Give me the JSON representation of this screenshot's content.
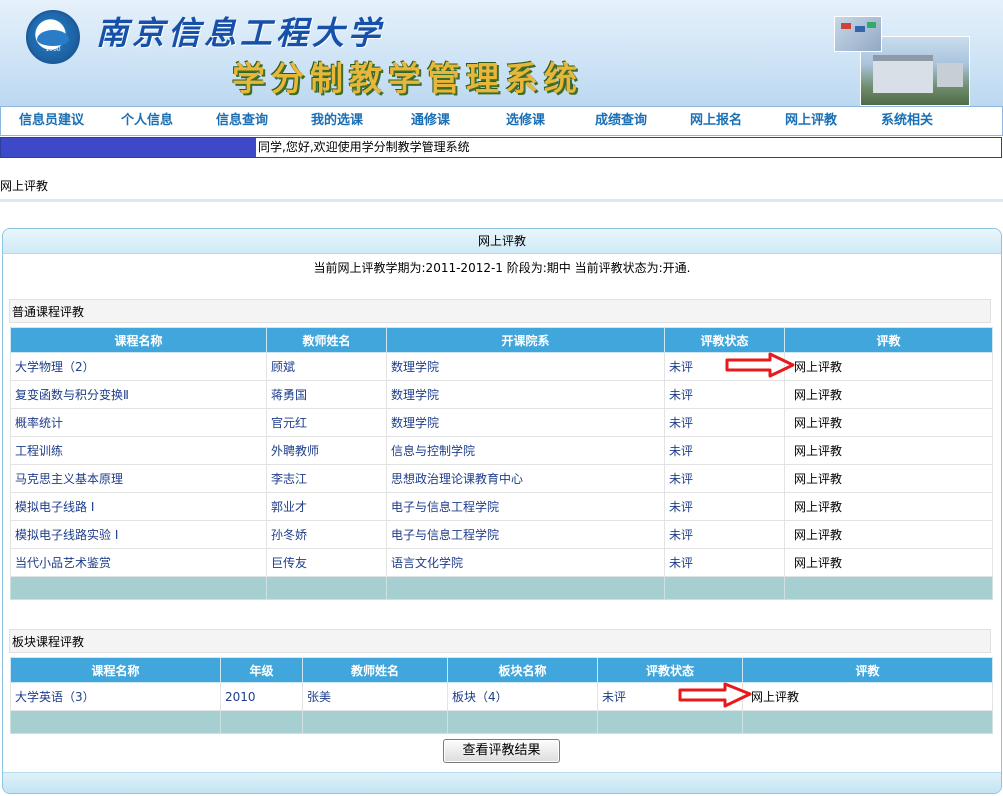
{
  "header": {
    "university": "南京信息工程大学",
    "system_name": "学分制教学管理系统",
    "logo_year": "1960"
  },
  "nav": [
    {
      "label": "信息员建议"
    },
    {
      "label": "个人信息"
    },
    {
      "label": "信息查询"
    },
    {
      "label": "我的选课"
    },
    {
      "label": "通修课"
    },
    {
      "label": "选修课"
    },
    {
      "label": "成绩查询"
    },
    {
      "label": "网上报名"
    },
    {
      "label": "网上评教"
    },
    {
      "label": "系统相关"
    }
  ],
  "status": {
    "welcome": "同学,您好,欢迎使用学分制教学管理系统"
  },
  "breadcrumb": "网上评教",
  "panel": {
    "title": "网上评教",
    "term_info": "当前网上评教学期为:2011-2012-1 阶段为:期中  当前评教状态为:开通."
  },
  "regular": {
    "section_title": "普通课程评教",
    "headers": [
      "课程名称",
      "教师姓名",
      "开课院系",
      "评教状态",
      "评教"
    ],
    "rows": [
      {
        "course": "大学物理（2）",
        "teacher": "顾斌",
        "dept": "数理学院",
        "status": "未评",
        "action": "网上评教"
      },
      {
        "course": "复变函数与积分变换Ⅱ",
        "teacher": "蒋勇国",
        "dept": "数理学院",
        "status": "未评",
        "action": "网上评教"
      },
      {
        "course": "概率统计",
        "teacher": "官元红",
        "dept": "数理学院",
        "status": "未评",
        "action": "网上评教"
      },
      {
        "course": "工程训练",
        "teacher": "外聘教师",
        "dept": "信息与控制学院",
        "status": "未评",
        "action": "网上评教"
      },
      {
        "course": "马克思主义基本原理",
        "teacher": "李志江",
        "dept": "思想政治理论课教育中心",
        "status": "未评",
        "action": "网上评教"
      },
      {
        "course": "模拟电子线路 I",
        "teacher": "郭业才",
        "dept": "电子与信息工程学院",
        "status": "未评",
        "action": "网上评教"
      },
      {
        "course": "模拟电子线路实验 I",
        "teacher": "孙冬娇",
        "dept": "电子与信息工程学院",
        "status": "未评",
        "action": "网上评教"
      },
      {
        "course": "当代小品艺术鉴赏",
        "teacher": "巨传友",
        "dept": "语言文化学院",
        "status": "未评",
        "action": "网上评教"
      }
    ]
  },
  "module": {
    "section_title": "板块课程评教",
    "headers": [
      "课程名称",
      "年级",
      "教师姓名",
      "板块名称",
      "评教状态",
      "评教"
    ],
    "rows": [
      {
        "course": "大学英语（3）",
        "grade": "2010",
        "teacher": "张美",
        "module": "板块（4）",
        "status": "未评",
        "action": "网上评教"
      }
    ]
  },
  "view_results_button": "查看评教结果",
  "colors": {
    "header_blue": "#41a6db",
    "arrow_red": "#e8191b",
    "nav_text": "#1b6fb5",
    "footer_row": "#a5cfd1"
  }
}
